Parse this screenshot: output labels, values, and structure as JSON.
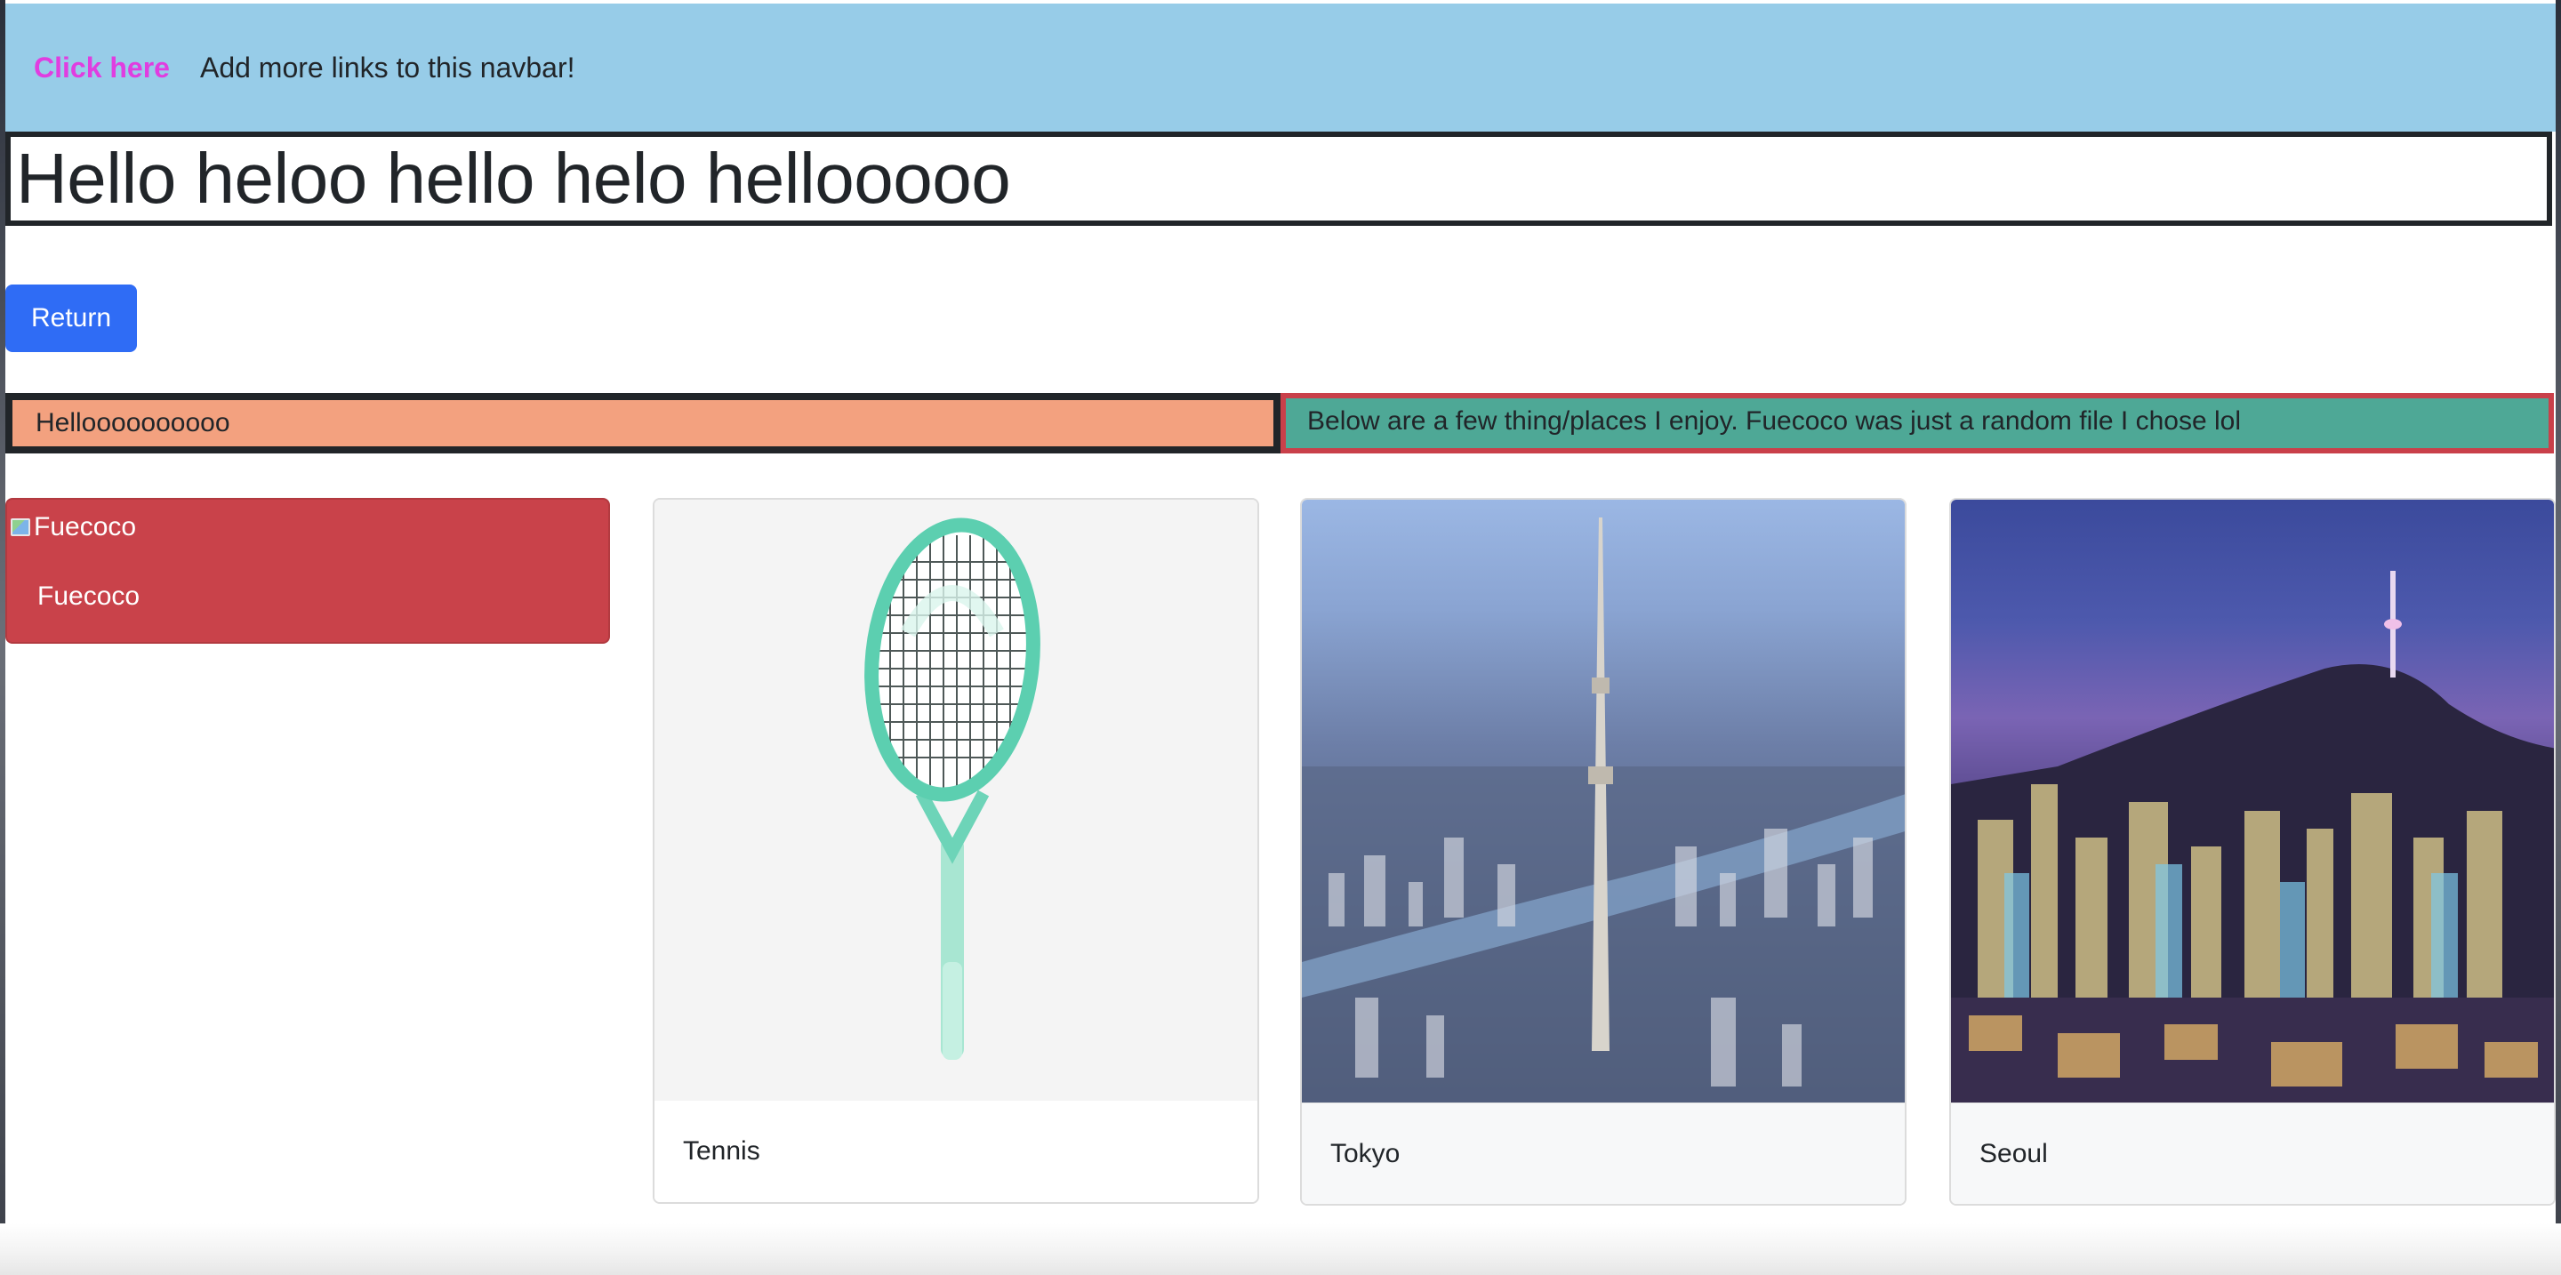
{
  "navbar": {
    "link_label": "Click here",
    "text": "Add more links to this navbar!",
    "background": "#97cce8",
    "link_color": "#e03de0"
  },
  "headline": {
    "text": "Hello heloo hello helo hellooooo"
  },
  "return_button": {
    "label": "Return",
    "color": "#2f6cf5"
  },
  "info_row": {
    "left_text": "Helloooooooooo",
    "left_color": "#f3a17f",
    "right_text": "Below are a few thing/places I enjoy. Fuecoco was just a random file I chose lol",
    "right_color": "#4ea896"
  },
  "cards": [
    {
      "title": "Fuecoco",
      "image_alt": "Fuecoco",
      "image_state": "broken-image",
      "color": "#c9424a"
    },
    {
      "title": "Tennis",
      "image_alt": "Tennis racket",
      "icon": "tennis-racket-image"
    },
    {
      "title": "Tokyo",
      "image_alt": "Tokyo skyline",
      "icon": "tokyo-city-image"
    },
    {
      "title": "Seoul",
      "image_alt": "Seoul skyline",
      "icon": "seoul-city-image"
    }
  ]
}
